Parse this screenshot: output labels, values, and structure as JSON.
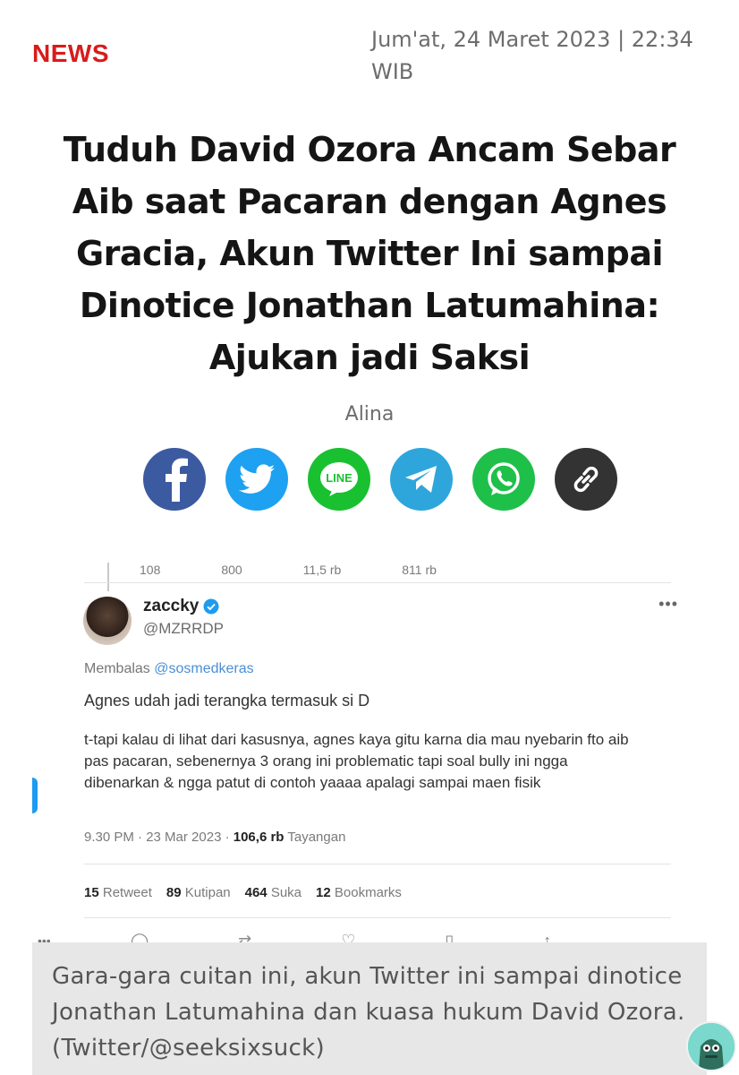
{
  "header": {
    "category": "NEWS",
    "date": "Jum'at, 24 Maret 2023 | 22:34 WIB"
  },
  "article": {
    "title": "Tuduh David Ozora Ancam Sebar Aib saat Pacaran dengan Agnes Gracia, Akun Twitter Ini sampai Dinotice Jonathan Latumahina: Ajukan jadi Saksi",
    "author": "Alina"
  },
  "share": [
    {
      "name": "facebook-icon",
      "color": "#3b5aa0"
    },
    {
      "name": "twitter-icon",
      "color": "#1ea1f1"
    },
    {
      "name": "line-icon",
      "color": "#19c130",
      "text": "LINE"
    },
    {
      "name": "telegram-icon",
      "color": "#2ea6db"
    },
    {
      "name": "whatsapp-icon",
      "color": "#1fc04a"
    },
    {
      "name": "link-icon",
      "color": "#333333"
    }
  ],
  "tweet": {
    "top_stats": [
      "108",
      "800",
      "11,5 rb",
      "811 rb"
    ],
    "display_name": "zaccky",
    "handle": "@MZRRDP",
    "replying_prefix": "Membalas",
    "replying_to": "@sosmedkeras",
    "line1": "Agnes udah jadi terangka termasuk si D",
    "body": "t-tapi kalau di lihat dari kasusnya, agnes kaya gitu karna dia mau nyebarin fto aib pas pacaran, sebenernya 3 orang ini problematic tapi soal bully ini ngga dibenarkan & ngga patut di contoh yaaaa apalagi sampai maen fisik",
    "time": "9.30 PM · 23 Mar 2023 ·",
    "views": "106,6 rb",
    "views_label": "Tayangan",
    "retweets": "15",
    "retweets_label": "Retweet",
    "quotes": "89",
    "quotes_label": "Kutipan",
    "likes": "464",
    "likes_label": "Suka",
    "bookmarks": "12",
    "bookmarks_label": "Bookmarks"
  },
  "caption": "Gara-gara cuitan ini, akun Twitter ini sampai dinotice Jonathan Latumahina dan kuasa hukum David Ozora. (Twitter/@seeksixsuck)"
}
